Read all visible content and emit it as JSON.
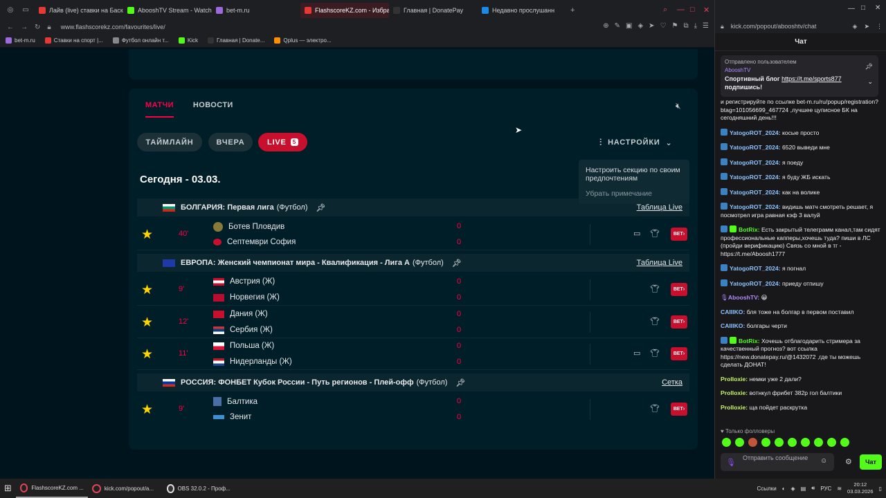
{
  "browser": {
    "tabs": [
      {
        "label": "Лайв (live) ставки на Баскетбол",
        "color": "#e53935"
      },
      {
        "label": "AbooshTV Stream - Watch",
        "color": "#53fc18"
      },
      {
        "label": "bet-m.ru",
        "color": "#9c6ade"
      },
      {
        "label": "FlashscoreKZ.com - Избранное",
        "color": "#e53935",
        "active": true
      },
      {
        "label": "Главная | DonatePay",
        "color": "#333333"
      },
      {
        "label": "Недавно прослушанн",
        "color": "#1e88e5"
      }
    ],
    "url": "www.flashscorekz.com/favourites/live/",
    "bookmarks": [
      {
        "label": "bet-m.ru",
        "color": "#9c6ade"
      },
      {
        "label": "Ставки на спорт |...",
        "color": "#e53935"
      },
      {
        "label": "Футбол онлайн т...",
        "color": "#888888"
      },
      {
        "label": "Kick",
        "color": "#53fc18"
      },
      {
        "label": "Главная | Donate...",
        "color": "#333333"
      },
      {
        "label": "Qplus — электро...",
        "color": "#ff8f00"
      }
    ]
  },
  "flashscore": {
    "tab_matches": "МАТЧИ",
    "tab_news": "НОВОСТИ",
    "pill_timeline": "ТАЙМЛАЙН",
    "pill_yesterday": "ВЧЕРА",
    "pill_live": "LIVE",
    "live_count": "5",
    "settings": "НАСТРОЙКИ",
    "tooltip_text": "Настроить секцию по своим предпочтениям",
    "tooltip_dismiss": "Убрать примечание",
    "date_header": "Сегодня - 03.03.",
    "bet_label": "BET",
    "leagues": [
      {
        "country": "БОЛГАРИЯ",
        "name": "Первая лига",
        "sport": "(Футбол)",
        "link": "Таблица Live"
      },
      {
        "country": "ЕВРОПА",
        "name": "Женский чемпионат мира - Квалификация - Лига А",
        "sport": "(Футбол)",
        "link": "Таблица Live"
      },
      {
        "country": "РОССИЯ",
        "name": "ФОНБЕТ Кубок России - Путь регионов - Плей-офф",
        "sport": "(Футбол)",
        "link": "Сетка"
      }
    ],
    "matches": [
      {
        "minute": "40'",
        "home": "Ботев Пловдив",
        "away": "Септември София",
        "home_score": "0",
        "away_score": "0"
      },
      {
        "minute": "9'",
        "home": "Австрия (Ж)",
        "away": "Норвегия (Ж)",
        "home_score": "0",
        "away_score": "0"
      },
      {
        "minute": "12'",
        "home": "Дания (Ж)",
        "away": "Сербия (Ж)",
        "home_score": "0",
        "away_score": "0"
      },
      {
        "minute": "11'",
        "home": "Польша (Ж)",
        "away": "Нидерланды (Ж)",
        "home_score": "0",
        "away_score": "0"
      },
      {
        "minute": "9'",
        "home": "Балтика",
        "away": "Зенит",
        "home_score": "0",
        "away_score": "0"
      }
    ]
  },
  "chat": {
    "url": "kick.com/popout/abooshtv/chat",
    "header": "Чат",
    "pinned_by": "Отправлено пользователем",
    "pinned_user": "AbooshTV",
    "pinned_text": "Спортивный блог",
    "pinned_link": "https://t.me/sports877",
    "pinned_text2": "подпишись!",
    "messages": [
      {
        "user": "",
        "text": "и регистрируйте по ссылке bet-m.ru/ru/popup/registration?btag=101056699_467724 ,лучшее цуписное БК на сегодняшний день!!!",
        "color": "#efeff1"
      },
      {
        "user": "YatogoROT_2024:",
        "text": "косые просто",
        "color": "#8fc3ff"
      },
      {
        "user": "YatogoROT_2024:",
        "text": "6520 выведи мне",
        "color": "#8fc3ff"
      },
      {
        "user": "YatogoROT_2024:",
        "text": "я поеду",
        "color": "#8fc3ff"
      },
      {
        "user": "YatogoROT_2024:",
        "text": "я буду ЖБ искать",
        "color": "#8fc3ff"
      },
      {
        "user": "YatogoROT_2024:",
        "text": "как на волике",
        "color": "#8fc3ff"
      },
      {
        "user": "YatogoROT_2024:",
        "text": "видишь матч смотреть решает, я посмотрел игра равная кэф 3 валуй",
        "color": "#8fc3ff"
      },
      {
        "user": "BotRix:",
        "text": "Есть закрытый телеграмм канал,там сидят профессиональные капперы,хочешь туда? пиши в ЛС (пройди верификацию) Связь со мной в тг - https://t.me/Aboosh1777",
        "color": "#53fc18"
      },
      {
        "user": "YatogoROT_2024:",
        "text": "я погнал",
        "color": "#8fc3ff"
      },
      {
        "user": "YatogoROT_2024:",
        "text": "приеду отпишу",
        "color": "#8fc3ff"
      },
      {
        "user": "AbooshTV:",
        "text": "😀",
        "color": "#b08bff"
      },
      {
        "user": "CAIIIKO:",
        "text": "бля тоже на болгар в первом поставил",
        "color": "#8fc3ff"
      },
      {
        "user": "CAIIIKO:",
        "text": "болгары черти",
        "color": "#8fc3ff"
      },
      {
        "user": "BotRix:",
        "text": "Хочешь отблагодарить стримера за качественный прогноз? вот ссылка https://new.donatepay.ru/@1432072 ,где ты можешь сделать ДОНАТ!",
        "color": "#53fc18"
      },
      {
        "user": "Prolloxie:",
        "text": "немки уже 2 дали?",
        "color": "#c7f464"
      },
      {
        "user": "Prolloxie:",
        "text": "вотнкул фрибет 382р гол балтики",
        "color": "#c7f464"
      },
      {
        "user": "Prolloxie:",
        "text": "ща пойдет раскрутка",
        "color": "#c7f464"
      }
    ],
    "followers_only": "Только фолловеры",
    "input_placeholder": "Отправить сообщение",
    "send_label": "Чат"
  },
  "taskbar": {
    "items": [
      {
        "label": "FlashscoreKZ.com ..."
      },
      {
        "label": "kick.com/popout/a..."
      },
      {
        "label": "OBS 32.0.2 - Проф..."
      }
    ],
    "tray_links": "Ссылки",
    "lang": "РУС",
    "time": "20:12",
    "date": "03.03.2026"
  }
}
